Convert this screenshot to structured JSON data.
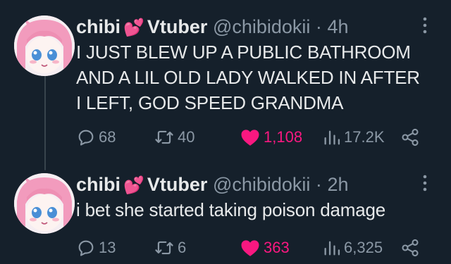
{
  "tweets": [
    {
      "display_name": "chibi",
      "name_suffix": "Vtuber",
      "emoji": "💕",
      "handle": "@chibidokii",
      "separator": "·",
      "time": "4h",
      "text": "I JUST BLEW UP A PUBLIC BATHROOM AND A LIL OLD LADY WALKED IN AFTER I LEFT, GOD SPEED GRANDMA",
      "replies": "68",
      "retweets": "40",
      "likes": "1,108",
      "views": "17.2K",
      "liked": true
    },
    {
      "display_name": "chibi",
      "name_suffix": "Vtuber",
      "emoji": "💕",
      "handle": "@chibidokii",
      "separator": "·",
      "time": "2h",
      "text": "i bet she started taking poison damage",
      "replies": "13",
      "retweets": "6",
      "likes": "363",
      "views": "6,325",
      "liked": true
    }
  ],
  "colors": {
    "background": "#15202b",
    "text": "#e7e9ea",
    "muted": "#8b98a5",
    "like": "#f91880",
    "thread_line": "#38444d"
  },
  "icons": [
    "reply-icon",
    "retweet-icon",
    "heart-filled-icon",
    "views-icon",
    "share-icon",
    "more-icon"
  ]
}
